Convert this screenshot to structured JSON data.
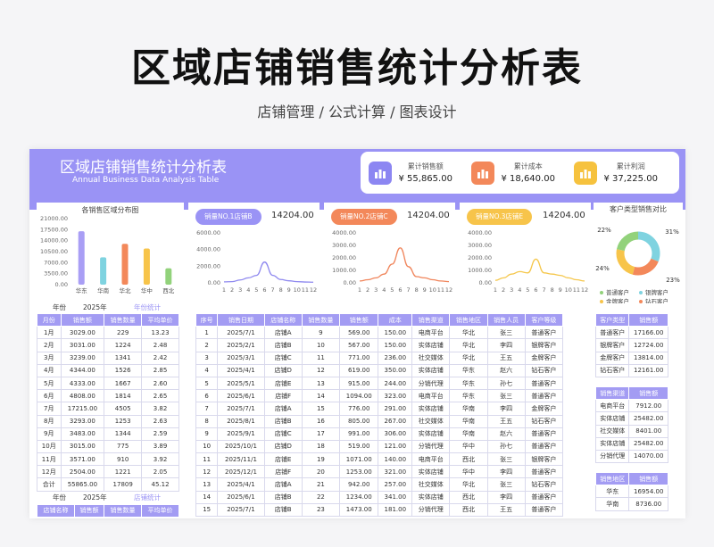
{
  "page": {
    "title": "区域店铺销售统计分析表",
    "subtitle": "店铺管理 / 公式计算 / 图表设计"
  },
  "banner": {
    "title": "区域店铺销售统计分析表",
    "subtitle": "Annual Business Data Analysis Table"
  },
  "kpis": [
    {
      "label": "累计销售额",
      "value": "¥ 55,865.00",
      "color": "#8c86f2",
      "icon": "bar-chart-icon"
    },
    {
      "label": "累计成本",
      "value": "¥ 18,640.00",
      "color": "#f3885a",
      "icon": "briefcase-icon"
    },
    {
      "label": "累计利润",
      "value": "¥ 37,225.00",
      "color": "#f6c23e",
      "icon": "bar-chart-icon"
    }
  ],
  "region_chart": {
    "chart_data": {
      "type": "bar",
      "title": "各销售区域分布图",
      "categories": [
        "华东",
        "华南",
        "华北",
        "华中",
        "西北"
      ],
      "values": [
        17000,
        8700,
        13000,
        11500,
        5200
      ],
      "ylim": [
        0,
        21000
      ],
      "yticks": [
        "21000.00",
        "17500.00",
        "14000.00",
        "10500.00",
        "7000.00",
        "3500.00",
        "0.00"
      ],
      "colors": [
        "#a99ef5",
        "#7fd3e0",
        "#f3885a",
        "#f7c44a",
        "#92d27b"
      ]
    }
  },
  "store_charts": [
    {
      "label": "销量NO.1店铺B",
      "value": "14204.00",
      "color": "#9a93f5",
      "line": "#8e88ef",
      "chart_data": {
        "type": "line",
        "x": [
          "1",
          "2",
          "3",
          "4",
          "5",
          "6",
          "7",
          "8",
          "9",
          "10",
          "11",
          "12"
        ],
        "values": [
          120,
          150,
          350,
          600,
          900,
          2500,
          900,
          400,
          250,
          150,
          100,
          80
        ],
        "ylim": [
          0,
          6000
        ],
        "yticks": [
          "6000.00",
          "4000.00",
          "2000.00",
          "0.00"
        ]
      }
    },
    {
      "label": "销量NO.2店铺C",
      "value": "14204.00",
      "color": "#f3885a",
      "line": "#f0845a",
      "chart_data": {
        "type": "line",
        "x": [
          "1",
          "2",
          "3",
          "4",
          "5",
          "6",
          "7",
          "8",
          "9",
          "10",
          "11",
          "12"
        ],
        "values": [
          150,
          250,
          400,
          700,
          1500,
          2800,
          1300,
          500,
          400,
          250,
          150,
          100
        ],
        "ylim": [
          0,
          4000
        ],
        "yticks": [
          "4000.00",
          "3000.00",
          "2000.00",
          "1000.00",
          "0.00"
        ]
      }
    },
    {
      "label": "销量NO.3店铺E",
      "value": "14204.00",
      "color": "#f7c44a",
      "line": "#f5c74c",
      "chart_data": {
        "type": "line",
        "x": [
          "1",
          "2",
          "3",
          "4",
          "5",
          "6",
          "7",
          "8",
          "9",
          "10",
          "11",
          "12"
        ],
        "values": [
          200,
          400,
          700,
          900,
          800,
          1900,
          800,
          700,
          600,
          400,
          250,
          150
        ],
        "ylim": [
          0,
          4000
        ],
        "yticks": [
          "4000.00",
          "3000.00",
          "2000.00",
          "1000.00",
          "0.00"
        ]
      }
    }
  ],
  "donut": {
    "chart_data": {
      "type": "pie",
      "title": "客户类型销售对比",
      "slices": [
        {
          "name": "普通客户",
          "value": 22,
          "label": "22%",
          "color": "#92d27b"
        },
        {
          "name": "银牌客户",
          "value": 31,
          "label": "31%",
          "color": "#7fd3e0"
        },
        {
          "name": "金牌客户",
          "value": 24,
          "label": "24%",
          "color": "#f7c44a"
        },
        {
          "name": "钻石客户",
          "value": 23,
          "label": "23%",
          "color": "#f3885a"
        }
      ]
    }
  },
  "monthly": {
    "year_label": "年份",
    "year_value": "2025年",
    "stat_label": "年份统计",
    "headers": [
      "月份",
      "销售额",
      "销售数量",
      "平均单价"
    ],
    "rows": [
      [
        "1月",
        "3029.00",
        "229",
        "13.23"
      ],
      [
        "2月",
        "3031.00",
        "1224",
        "2.48"
      ],
      [
        "3月",
        "3239.00",
        "1341",
        "2.42"
      ],
      [
        "4月",
        "4344.00",
        "1526",
        "2.85"
      ],
      [
        "5月",
        "4333.00",
        "1667",
        "2.60"
      ],
      [
        "6月",
        "4808.00",
        "1814",
        "2.65"
      ],
      [
        "7月",
        "17215.00",
        "4505",
        "3.82"
      ],
      [
        "8月",
        "3293.00",
        "1253",
        "2.63"
      ],
      [
        "9月",
        "3483.00",
        "1344",
        "2.59"
      ],
      [
        "10月",
        "3015.00",
        "775",
        "3.89"
      ],
      [
        "11月",
        "3571.00",
        "910",
        "3.92"
      ],
      [
        "12月",
        "2504.00",
        "1221",
        "2.05"
      ],
      [
        "合计",
        "55865.00",
        "17809",
        "45.12"
      ]
    ],
    "footer_year_label": "年份",
    "footer_year_value": "2025年",
    "footer_stat_label": "店铺统计",
    "footer_headers": [
      "店铺名称",
      "销售额",
      "销售数量",
      "平均单价"
    ]
  },
  "detail": {
    "headers": [
      "序号",
      "销售日期",
      "店铺名称",
      "销售数量",
      "销售额",
      "成本",
      "销售渠道",
      "销售地区",
      "销售人员",
      "客户等级"
    ],
    "rows": [
      [
        "1",
        "2025/7/1",
        "店铺A",
        "9",
        "569.00",
        "150.00",
        "电商平台",
        "华北",
        "张三",
        "普通客户"
      ],
      [
        "2",
        "2025/2/1",
        "店铺B",
        "10",
        "567.00",
        "150.00",
        "实体店铺",
        "华北",
        "李四",
        "银牌客户"
      ],
      [
        "3",
        "2025/3/1",
        "店铺C",
        "11",
        "771.00",
        "236.00",
        "社交媒体",
        "华北",
        "王五",
        "金牌客户"
      ],
      [
        "4",
        "2025/4/1",
        "店铺D",
        "12",
        "619.00",
        "350.00",
        "实体店铺",
        "华东",
        "赵六",
        "钻石客户"
      ],
      [
        "5",
        "2025/5/1",
        "店铺E",
        "13",
        "915.00",
        "244.00",
        "分销代理",
        "华东",
        "孙七",
        "普通客户"
      ],
      [
        "6",
        "2025/6/1",
        "店铺F",
        "14",
        "1094.00",
        "323.00",
        "电商平台",
        "华东",
        "张三",
        "普通客户"
      ],
      [
        "7",
        "2025/7/1",
        "店铺A",
        "15",
        "776.00",
        "291.00",
        "实体店铺",
        "华南",
        "李四",
        "金牌客户"
      ],
      [
        "8",
        "2025/8/1",
        "店铺B",
        "16",
        "805.00",
        "267.00",
        "社交媒体",
        "华南",
        "王五",
        "钻石客户"
      ],
      [
        "9",
        "2025/9/1",
        "店铺C",
        "17",
        "991.00",
        "306.00",
        "实体店铺",
        "华南",
        "赵六",
        "普通客户"
      ],
      [
        "10",
        "2025/10/1",
        "店铺D",
        "18",
        "519.00",
        "121.00",
        "分销代理",
        "华中",
        "孙七",
        "普通客户"
      ],
      [
        "11",
        "2025/11/1",
        "店铺E",
        "19",
        "1071.00",
        "140.00",
        "电商平台",
        "西北",
        "张三",
        "银牌客户"
      ],
      [
        "12",
        "2025/12/1",
        "店铺F",
        "20",
        "1253.00",
        "321.00",
        "实体店铺",
        "华中",
        "李四",
        "普通客户"
      ],
      [
        "13",
        "2025/4/1",
        "店铺A",
        "21",
        "942.00",
        "257.00",
        "社交媒体",
        "华北",
        "张三",
        "钻石客户"
      ],
      [
        "14",
        "2025/6/1",
        "店铺B",
        "22",
        "1234.00",
        "341.00",
        "实体店铺",
        "西北",
        "李四",
        "普通客户"
      ],
      [
        "15",
        "2025/7/1",
        "店铺B",
        "23",
        "1473.00",
        "181.00",
        "分销代理",
        "西北",
        "王五",
        "普通客户"
      ]
    ]
  },
  "customer_table": {
    "headers": [
      "客户类型",
      "销售额"
    ],
    "rows": [
      [
        "普通客户",
        "17166.00"
      ],
      [
        "银牌客户",
        "12724.00"
      ],
      [
        "金牌客户",
        "13814.00"
      ],
      [
        "钻石客户",
        "12161.00"
      ]
    ]
  },
  "channel_table": {
    "headers": [
      "销售渠道",
      "销售额"
    ],
    "rows": [
      [
        "电商平台",
        "7912.00"
      ],
      [
        "实体店铺",
        "25482.00"
      ],
      [
        "社交媒体",
        "8401.00"
      ],
      [
        "实体店铺",
        "25482.00"
      ],
      [
        "分销代理",
        "14070.00"
      ]
    ]
  },
  "area_table": {
    "headers": [
      "销售地区",
      "销售额"
    ],
    "rows": [
      [
        "华东",
        "16954.00"
      ],
      [
        "华南",
        "8736.00"
      ]
    ]
  }
}
